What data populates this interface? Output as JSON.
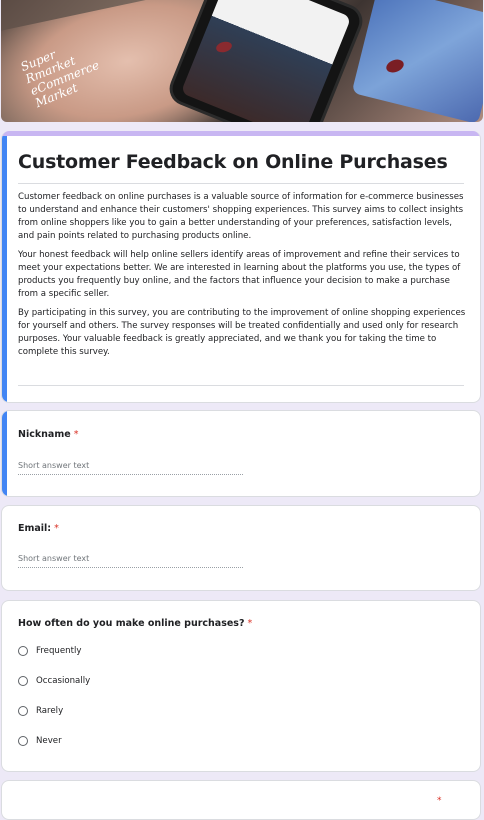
{
  "banner": {
    "screen_text": "Super\nRmarket\neCommerce\nMarket"
  },
  "form": {
    "title": "Customer Feedback on Online Purchases",
    "description": [
      "Customer feedback on online purchases is a valuable source of information for e-commerce businesses to understand and enhance their customers' shopping experiences. This survey aims to collect insights from online shoppers like you to gain a better understanding of your preferences, satisfaction levels, and pain points related to purchasing products online.",
      "Your honest feedback will help online sellers identify areas of improvement and refine their services to meet your expectations better. We are interested in learning about the platforms you use, the types of products you frequently buy online, and the factors that influence your decision to make a purchase from a specific seller.",
      "By participating in this survey, you are contributing to the improvement of online shopping experiences for yourself and others. The survey responses will be treated confidentially and used only for research purposes. Your valuable feedback is greatly appreciated, and we thank you for taking the time to complete this survey."
    ]
  },
  "questions": {
    "nickname": {
      "label": "Nickname",
      "required": "*",
      "placeholder": "Short answer text"
    },
    "email": {
      "label": "Email:",
      "required": "*",
      "placeholder": "Short answer text"
    },
    "frequency": {
      "label": "How often do you make online purchases?",
      "required": "*",
      "options": [
        "Frequently",
        "Occasionally",
        "Rarely",
        "Never"
      ]
    },
    "next": {
      "required": "*"
    }
  },
  "colors": {
    "background": "#ede9f7",
    "theme_top": "#c8b6f2",
    "active_accent": "#4285f4",
    "required": "#d93025"
  }
}
